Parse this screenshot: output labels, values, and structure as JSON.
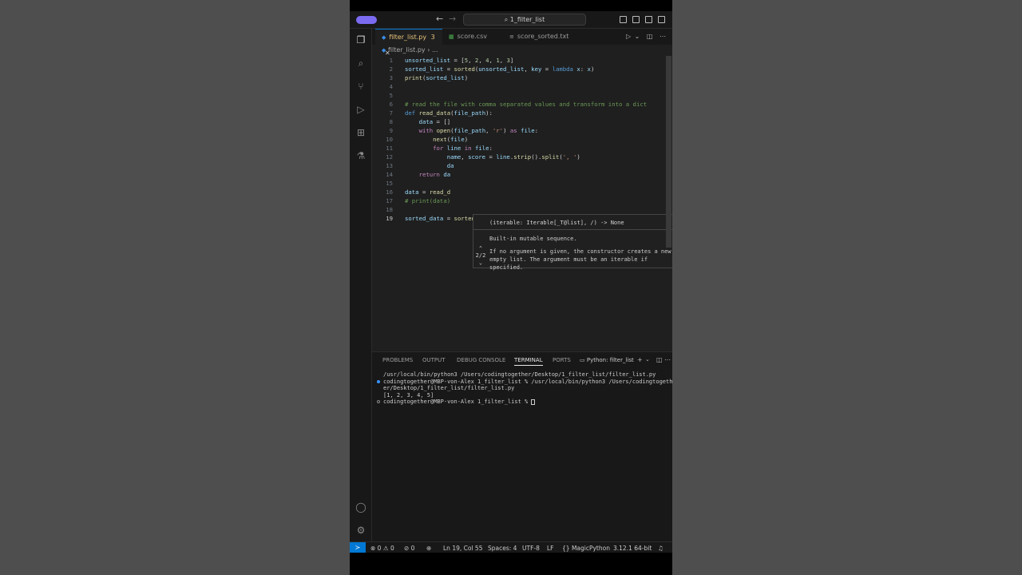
{
  "titlebar": {
    "search_label": "⌕ 1_filter_list"
  },
  "tabs": [
    {
      "label": "filter_list.py",
      "badge": "3",
      "icon": "python-icon",
      "active": true
    },
    {
      "label": "score.csv",
      "icon": "csv-icon",
      "active": false
    },
    {
      "label": "score_sorted.txt",
      "icon": "text-file-icon",
      "active": false
    }
  ],
  "breadcrumb": {
    "file": "filter_list.py",
    "trail": "› ..."
  },
  "editor": {
    "current_line": "19",
    "lines": [
      {
        "n": "1"
      },
      {
        "n": "2"
      },
      {
        "n": "3"
      },
      {
        "n": "4"
      },
      {
        "n": "5"
      },
      {
        "n": "6"
      },
      {
        "n": "7"
      },
      {
        "n": "8"
      },
      {
        "n": "9"
      },
      {
        "n": "10"
      },
      {
        "n": "11"
      },
      {
        "n": "12"
      },
      {
        "n": "13"
      },
      {
        "n": "14"
      },
      {
        "n": "15"
      },
      {
        "n": "16"
      },
      {
        "n": "17"
      },
      {
        "n": "18"
      },
      {
        "n": "19"
      }
    ]
  },
  "hover": {
    "signature": "(iterable: Iterable[_T@list], /) -> None",
    "line1": "Built-in mutable sequence.",
    "line2": "If no argument is given, the constructor creates a new empty list. The argument must be an iterable if specified.",
    "page": "2/2"
  },
  "panel": {
    "tabs": [
      "PROBLEMS",
      "OUTPUT",
      "DEBUG CONSOLE",
      "TERMINAL",
      "PORTS"
    ],
    "active_tab": "TERMINAL",
    "terminal_name": "Python: filter_list",
    "lines": [
      "/usr/local/bin/python3 /Users/codingtogether/Desktop/1_filter_list/filter_list.py",
      "codingtogether@MBP-von-Alex 1_filter_list % /usr/local/bin/python3 /Users/codingtogeth",
      "er/Desktop/1_filter_list/filter_list.py",
      "[1, 2, 3, 4, 5]",
      "codingtogether@MBP-von-Alex 1_filter_list % "
    ]
  },
  "statusbar": {
    "errors": "0",
    "warnings": "0",
    "ports": "0",
    "position": "Ln 19, Col 55",
    "spaces": "Spaces: 4",
    "encoding": "UTF-8",
    "eol": "LF",
    "language": "MagicPython",
    "interpreter": "3.12.1 64-bit"
  },
  "colors": {
    "accent": "#0078d4",
    "badge": "#7b6bf0",
    "editor_bg": "#1f1f1f",
    "chrome_bg": "#181818"
  }
}
